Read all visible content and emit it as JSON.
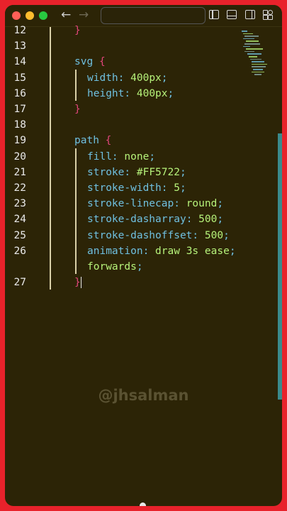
{
  "window": {
    "traffic_lights": [
      "close",
      "minimize",
      "zoom"
    ],
    "address_text": ""
  },
  "editor": {
    "lines": [
      {
        "num": "12",
        "code": "}"
      },
      {
        "num": "13",
        "code": ""
      },
      {
        "num": "14",
        "selector": "svg",
        "open": "{"
      },
      {
        "num": "15",
        "prop": "width",
        "value": "400px"
      },
      {
        "num": "16",
        "prop": "height",
        "value": "400px"
      },
      {
        "num": "17",
        "close": "}"
      },
      {
        "num": "18",
        "code": ""
      },
      {
        "num": "19",
        "selector": "path",
        "open": "{"
      },
      {
        "num": "20",
        "prop": "fill",
        "value": "none"
      },
      {
        "num": "21",
        "prop": "stroke",
        "value": "#FF5722"
      },
      {
        "num": "22",
        "prop": "stroke-width",
        "value": "5"
      },
      {
        "num": "23",
        "prop": "stroke-linecap",
        "value": "round"
      },
      {
        "num": "24",
        "prop": "stroke-dasharray",
        "value": "500"
      },
      {
        "num": "25",
        "prop": "stroke-dashoffset",
        "value": "500"
      },
      {
        "num": "26",
        "prop": "animation",
        "value": "draw 3s ease"
      },
      {
        "num": "",
        "value": "forwards"
      },
      {
        "num": "27",
        "close": "}"
      }
    ]
  },
  "watermark": "@jhsalman",
  "colors": {
    "background": "#2c2406",
    "border": "#e8222b",
    "selector": "#6fc0e0",
    "brace": "#e0457b",
    "value": "#b6f27a",
    "scrollbar": "#3a8a8c"
  }
}
